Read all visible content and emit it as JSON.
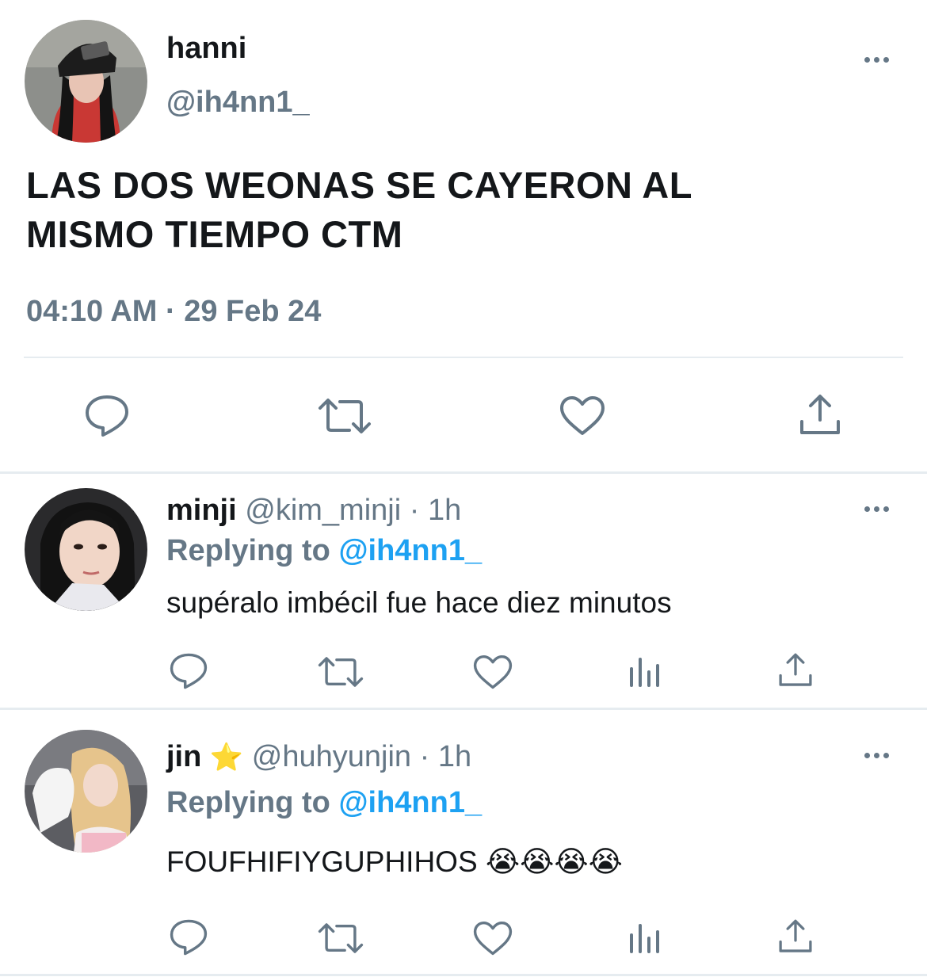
{
  "main_tweet": {
    "name": "hanni",
    "handle": "@ih4nn1_",
    "text": "LAS DOS WEONAS SE CAYERON AL MISMO TIEMPO CTM",
    "time": "04:10 AM",
    "separator": "·",
    "date": "29 Feb 24"
  },
  "replies": [
    {
      "name": "minji",
      "handle": "@kim_minji",
      "separator": "·",
      "time": "1h",
      "replying_label": "Replying to",
      "replying_handle": "@ih4nn1_",
      "text": "supéralo imbécil fue hace diez minutos"
    },
    {
      "name": "jin",
      "badge": "⭐",
      "handle": "@huhyunjin",
      "separator": "·",
      "time": "1h",
      "replying_label": "Replying to",
      "replying_handle": "@ih4nn1_",
      "text": "FOUFHIFIYGUPHIHOS 😭😭😭😭"
    }
  ],
  "colors": {
    "text": "#14171a",
    "secondary": "#657786",
    "link": "#1da1f2",
    "divider": "#e6ecf0"
  },
  "icons": {
    "main_actions": [
      "reply-icon",
      "retweet-icon",
      "like-icon",
      "share-icon"
    ],
    "reply_actions": [
      "reply-icon",
      "retweet-icon",
      "like-icon",
      "analytics-icon",
      "share-icon"
    ]
  }
}
